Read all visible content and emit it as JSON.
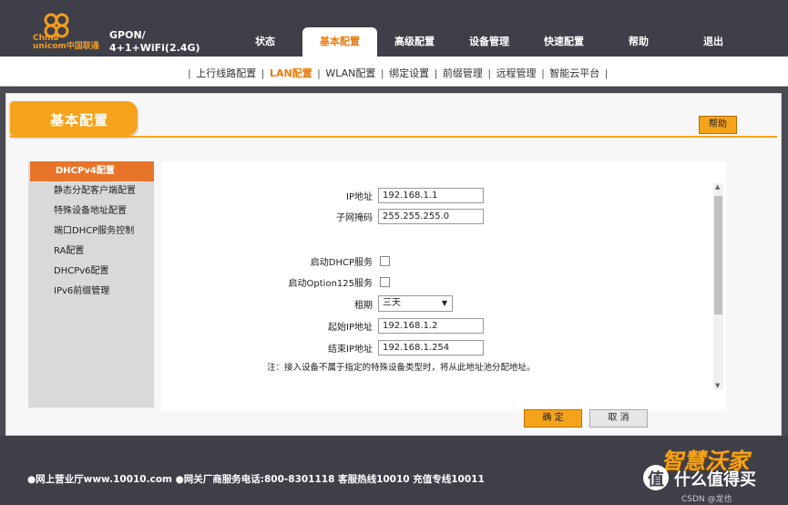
{
  "brand": {
    "logo_text_line1": "China",
    "logo_text_line2": "unicom中国联通",
    "model_line1": "GPON/",
    "model_line2": "4+1+WiFi(2.4G)"
  },
  "nav": {
    "items": [
      {
        "label": "状态"
      },
      {
        "label": "基本配置"
      },
      {
        "label": "高级配置"
      },
      {
        "label": "设备管理"
      },
      {
        "label": "快速配置"
      },
      {
        "label": "帮助"
      },
      {
        "label": "退出"
      }
    ],
    "active_index": 1
  },
  "subnav": {
    "items": [
      "上行线路配置",
      "LAN配置",
      "WLAN配置",
      "绑定设置",
      "前缀管理",
      "远程管理",
      "智能云平台"
    ],
    "selected": "LAN配置"
  },
  "panel": {
    "title": "基本配置",
    "help_label": "帮助"
  },
  "sidebar": {
    "items": [
      {
        "label": "DHCPv4配置"
      },
      {
        "label": "静态分配客户端配置"
      },
      {
        "label": "特殊设备地址配置"
      },
      {
        "label": "端口DHCP服务控制"
      },
      {
        "label": "RA配置"
      },
      {
        "label": "DHCPv6配置"
      },
      {
        "label": "IPv6前缀管理"
      }
    ],
    "selected_index": 0
  },
  "form": {
    "ip_label": "IP地址",
    "ip_value": "192.168.1.1",
    "mask_label": "子网掩码",
    "mask_value": "255.255.255.0",
    "dhcp_label": "启动DHCP服务",
    "dhcp_checked": false,
    "option125_label": "启动Option125服务",
    "option125_checked": false,
    "lease_label": "租期",
    "lease_value": "三天",
    "start_ip_label": "起始IP地址",
    "start_ip_value": "192.168.1.2",
    "end_ip_label": "结束IP地址",
    "end_ip_value": "192.168.1.254",
    "note": "注：接入设备不属于指定的特殊设备类型时，将从此地址池分配地址。"
  },
  "buttons": {
    "ok": "确 定",
    "cancel": "取 消"
  },
  "footer": {
    "text": "●网上营业厅www.10010.com ●网关厂商服务电话:800-8301118 客服热线10010 充值专线10011",
    "brand": "智慧沃家",
    "watermark": "什么值得买",
    "watermark_sub": "CSDN @龙也"
  },
  "colors": {
    "accent": "#f5a31a",
    "dark_bg": "#3e3f48",
    "selected_red": "#e8742a"
  }
}
